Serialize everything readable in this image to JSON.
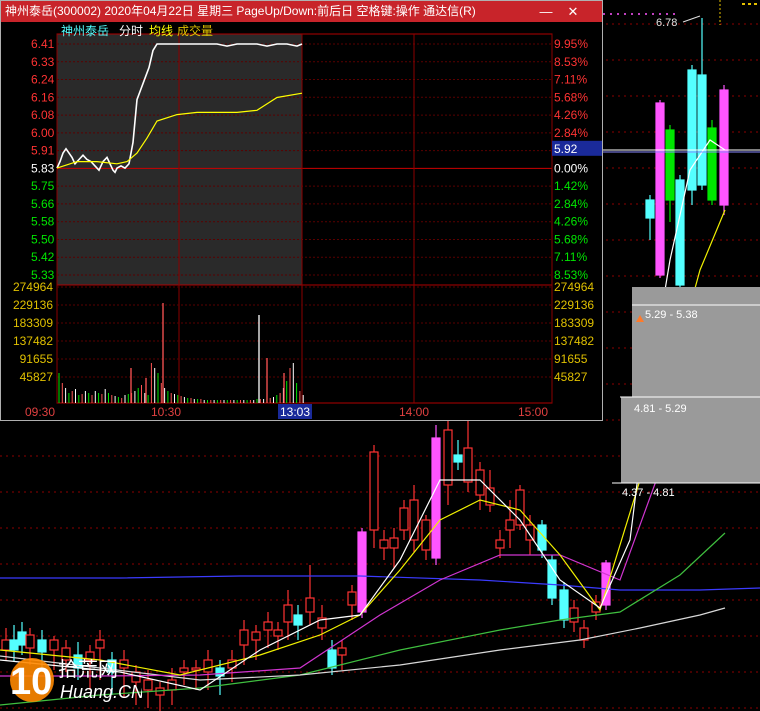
{
  "window": {
    "title": "神州泰岳(300002)  2020年04月22日  星期三  PageUp/Down:前后日  空格键:操作  通达信(R)",
    "min_icon": "minimize-icon",
    "close_icon": "close-icon",
    "min_glyph": "—",
    "close_glyph": "✕"
  },
  "legend": {
    "stock": "神州泰岳",
    "fenshi": "分时",
    "junxian": "均线",
    "volume": "成交量"
  },
  "colors": {
    "red": "#ff3333",
    "cyan": "#54ffff",
    "magenta": "#ff55ff",
    "green": "#00e600",
    "yellow": "#ffff00",
    "grid": "#8b0000",
    "titlebar": "#c8242a"
  },
  "overlay": {
    "high_label": "6.78",
    "price_marker": "5.92",
    "range1": "5.29 - 5.38",
    "range2": "4.81 - 5.29",
    "range3": "4.37 - 4.81"
  },
  "logo": {
    "big": "10",
    "text_top": "拾荒网",
    "text_bottom": "Huang.CN"
  },
  "chart_data": {
    "type": "line",
    "title": "神州泰岳 分时",
    "y_left_ticks": [
      "6.41",
      "6.33",
      "6.24",
      "6.16",
      "6.08",
      "6.00",
      "5.91",
      "5.83",
      "5.75",
      "5.66",
      "5.58",
      "5.50",
      "5.42",
      "5.33"
    ],
    "y_right_ticks": [
      "9.95%",
      "8.53%",
      "7.11%",
      "5.68%",
      "4.26%",
      "2.84%",
      "1.42%",
      "0.00%",
      "1.42%",
      "2.84%",
      "4.26%",
      "5.68%",
      "7.11%",
      "8.53%"
    ],
    "prev_close": 5.83,
    "ylim": [
      5.33,
      6.41
    ],
    "x_ticks": [
      "09:30",
      "10:30",
      "13:03",
      "14:00",
      "15:00"
    ],
    "volume_ticks": [
      "274964",
      "229136",
      "183309",
      "137482",
      "91655",
      "45827"
    ],
    "volume_ylim": [
      0,
      274964
    ],
    "series": [
      {
        "name": "分时",
        "x": [
          0,
          3,
          6,
          9,
          12,
          15,
          18,
          22,
          26,
          30,
          34,
          38,
          42,
          46,
          50,
          52,
          54,
          56,
          58,
          60,
          64,
          68,
          72,
          76,
          80,
          84,
          88,
          92,
          96,
          100,
          110,
          120,
          130,
          140,
          150,
          160,
          170,
          180,
          190,
          200,
          210,
          220,
          230,
          240,
          245
        ],
        "values": [
          5.83,
          5.86,
          5.9,
          5.92,
          5.9,
          5.88,
          5.85,
          5.87,
          5.89,
          5.87,
          5.86,
          5.84,
          5.82,
          5.86,
          5.88,
          5.86,
          5.84,
          5.82,
          5.81,
          5.83,
          5.84,
          5.83,
          5.85,
          5.95,
          6.15,
          6.2,
          6.25,
          6.3,
          6.38,
          6.41,
          6.41,
          6.41,
          6.41,
          6.41,
          6.41,
          6.41,
          6.4,
          6.41,
          6.41,
          6.41,
          6.4,
          6.41,
          6.41,
          6.4,
          6.41
        ]
      },
      {
        "name": "均线",
        "x": [
          0,
          20,
          40,
          60,
          70,
          80,
          90,
          100,
          120,
          140,
          160,
          180,
          200,
          210,
          220,
          245
        ],
        "values": [
          5.83,
          5.86,
          5.86,
          5.85,
          5.86,
          5.9,
          5.97,
          6.05,
          6.08,
          6.09,
          6.09,
          6.09,
          6.1,
          6.13,
          6.16,
          6.18
        ]
      }
    ]
  }
}
